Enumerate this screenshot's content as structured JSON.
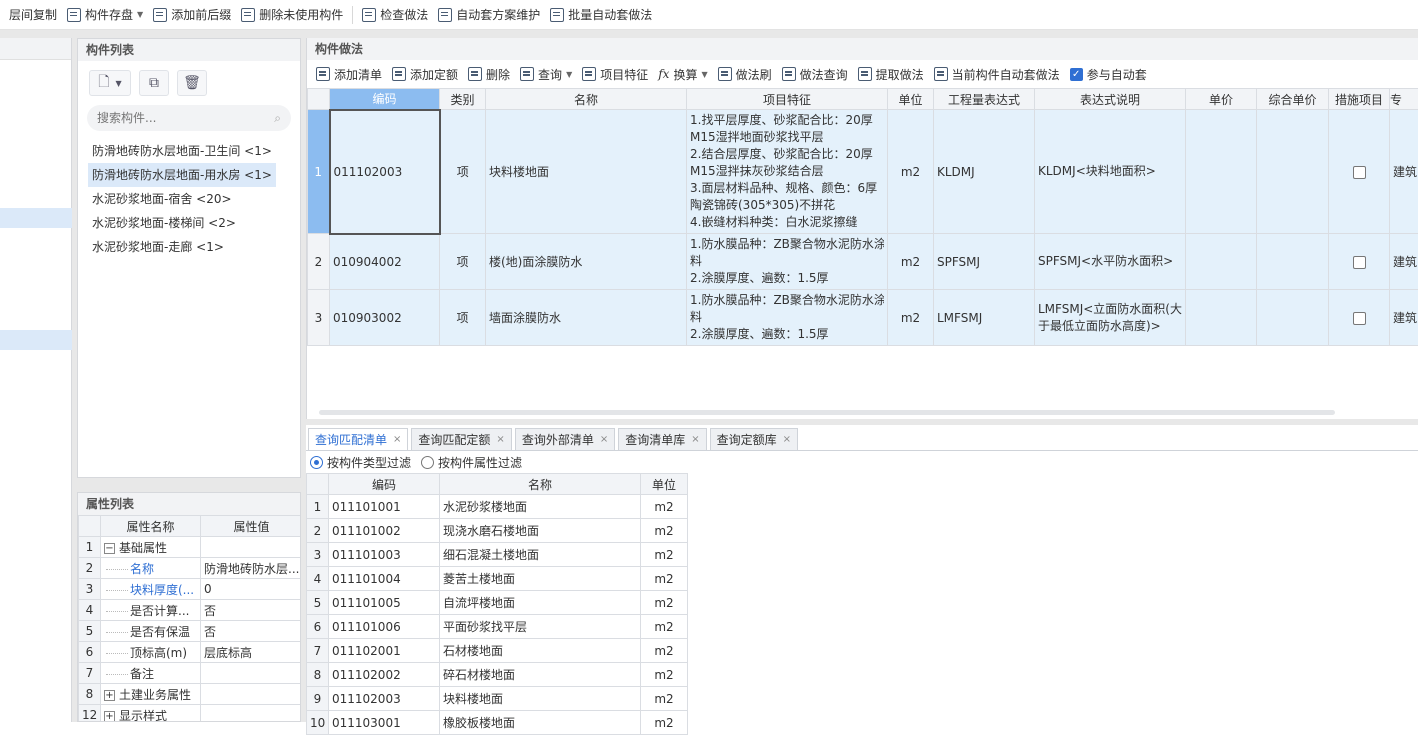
{
  "toolbar": {
    "items": [
      {
        "label": "层间复制"
      },
      {
        "label": "构件存盘"
      },
      {
        "label": "添加前后缀"
      },
      {
        "label": "删除未使用构件"
      },
      {
        "label": "检查做法"
      },
      {
        "label": "自动套方案维护"
      },
      {
        "label": "批量自动套做法"
      }
    ]
  },
  "component_list": {
    "title": "构件列表",
    "search_placeholder": "搜索构件...",
    "items": [
      {
        "label": "防滑地砖防水层地面-卫生间 <1>",
        "selected": false
      },
      {
        "label": "防滑地砖防水层地面-用水房 <1>",
        "selected": true
      },
      {
        "label": "水泥砂浆地面-宿舍 <20>",
        "selected": false
      },
      {
        "label": "水泥砂浆地面-楼梯间 <2>",
        "selected": false
      },
      {
        "label": "水泥砂浆地面-走廊 <1>",
        "selected": false
      }
    ]
  },
  "property_list": {
    "title": "属性列表",
    "headers": [
      "属性名称",
      "属性值"
    ],
    "rows": [
      {
        "num": "1",
        "name": "基础属性",
        "value": "",
        "expander": "−",
        "link": false
      },
      {
        "num": "2",
        "name": "名称",
        "value": "防滑地砖防水层...",
        "expander": "",
        "link": true
      },
      {
        "num": "3",
        "name": "块料厚度(...",
        "value": "0",
        "expander": "",
        "link": true
      },
      {
        "num": "4",
        "name": "是否计算...",
        "value": "否",
        "expander": "",
        "link": false
      },
      {
        "num": "5",
        "name": "是否有保温",
        "value": "否",
        "expander": "",
        "link": false
      },
      {
        "num": "6",
        "name": "顶标高(m)",
        "value": "层底标高",
        "expander": "",
        "link": false
      },
      {
        "num": "7",
        "name": "备注",
        "value": "",
        "expander": "",
        "link": false
      },
      {
        "num": "8",
        "name": "土建业务属性",
        "value": "",
        "expander": "+",
        "link": false
      },
      {
        "num": "12",
        "name": "显示样式",
        "value": "",
        "expander": "+",
        "link": false
      }
    ]
  },
  "method": {
    "title": "构件做法",
    "toolbar": [
      {
        "label": "添加清单"
      },
      {
        "label": "添加定额"
      },
      {
        "label": "删除"
      },
      {
        "label": "查询"
      },
      {
        "label": "项目特征"
      },
      {
        "label": "换算"
      },
      {
        "label": "做法刷"
      },
      {
        "label": "做法查询"
      },
      {
        "label": "提取做法"
      },
      {
        "label": "当前构件自动套做法"
      },
      {
        "label": "参与自动套"
      }
    ],
    "headers": [
      "编码",
      "类别",
      "名称",
      "项目特征",
      "单位",
      "工程量表达式",
      "表达式说明",
      "单价",
      "综合单价",
      "措施项目",
      "专"
    ],
    "rows": [
      {
        "num": "1",
        "code": "011102003",
        "type": "项",
        "name": "块料楼地面",
        "features": [
          "1.找平层厚度、砂浆配合比：20厚",
          "M15湿拌地面砂浆找平层",
          "2.结合层厚度、砂浆配合比：20厚",
          "M15湿拌抹灰砂浆结合层",
          "3.面层材料品种、规格、颜色：6厚",
          "陶瓷锦砖(305*305)不拼花",
          "4.嵌缝材料种类：白水泥浆擦缝"
        ],
        "unit": "m2",
        "expr": "KLDMJ",
        "desc": [
          "KLDMJ<块料地面积>"
        ],
        "spec": "建筑"
      },
      {
        "num": "2",
        "code": "010904002",
        "type": "项",
        "name": "楼(地)面涂膜防水",
        "features": [
          "1.防水膜品种：ZB聚合物水泥防水涂",
          "料",
          "2.涂膜厚度、遍数：1.5厚"
        ],
        "unit": "m2",
        "expr": "SPFSMJ",
        "desc": [
          "SPFSMJ<水平防水面积>"
        ],
        "spec": "建筑"
      },
      {
        "num": "3",
        "code": "010903002",
        "type": "项",
        "name": "墙面涂膜防水",
        "features": [
          "1.防水膜品种：ZB聚合物水泥防水涂",
          "料",
          "2.涂膜厚度、遍数：1.5厚"
        ],
        "unit": "m2",
        "expr": "LMFSMJ",
        "desc": [
          "LMFSMJ<立面防水面积(大",
          "于最低立面防水高度)>"
        ],
        "spec": "建筑"
      }
    ]
  },
  "query": {
    "tabs": [
      {
        "label": "查询匹配清单",
        "active": true
      },
      {
        "label": "查询匹配定额",
        "active": false
      },
      {
        "label": "查询外部清单",
        "active": false
      },
      {
        "label": "查询清单库",
        "active": false
      },
      {
        "label": "查询定额库",
        "active": false
      }
    ],
    "filters": [
      {
        "label": "按构件类型过滤",
        "checked": true
      },
      {
        "label": "按构件属性过滤",
        "checked": false
      }
    ],
    "headers": [
      "编码",
      "名称",
      "单位"
    ],
    "rows": [
      {
        "num": "1",
        "code": "011101001",
        "name": "水泥砂浆楼地面",
        "unit": "m2"
      },
      {
        "num": "2",
        "code": "011101002",
        "name": "现浇水磨石楼地面",
        "unit": "m2"
      },
      {
        "num": "3",
        "code": "011101003",
        "name": "细石混凝土楼地面",
        "unit": "m2"
      },
      {
        "num": "4",
        "code": "011101004",
        "name": "菱苦土楼地面",
        "unit": "m2"
      },
      {
        "num": "5",
        "code": "011101005",
        "name": "自流坪楼地面",
        "unit": "m2"
      },
      {
        "num": "6",
        "code": "011101006",
        "name": "平面砂浆找平层",
        "unit": "m2"
      },
      {
        "num": "7",
        "code": "011102001",
        "name": "石材楼地面",
        "unit": "m2"
      },
      {
        "num": "8",
        "code": "011102002",
        "name": "碎石材楼地面",
        "unit": "m2"
      },
      {
        "num": "9",
        "code": "011102003",
        "name": "块料楼地面",
        "unit": "m2"
      },
      {
        "num": "10",
        "code": "011103001",
        "name": "橡胶板楼地面",
        "unit": "m2"
      }
    ]
  },
  "colors": {
    "accent": "#2f6fd3",
    "selected_row": "#e4f1fb",
    "selected_header": "#8cbcf0",
    "list_sel": "#dbe9f9"
  }
}
